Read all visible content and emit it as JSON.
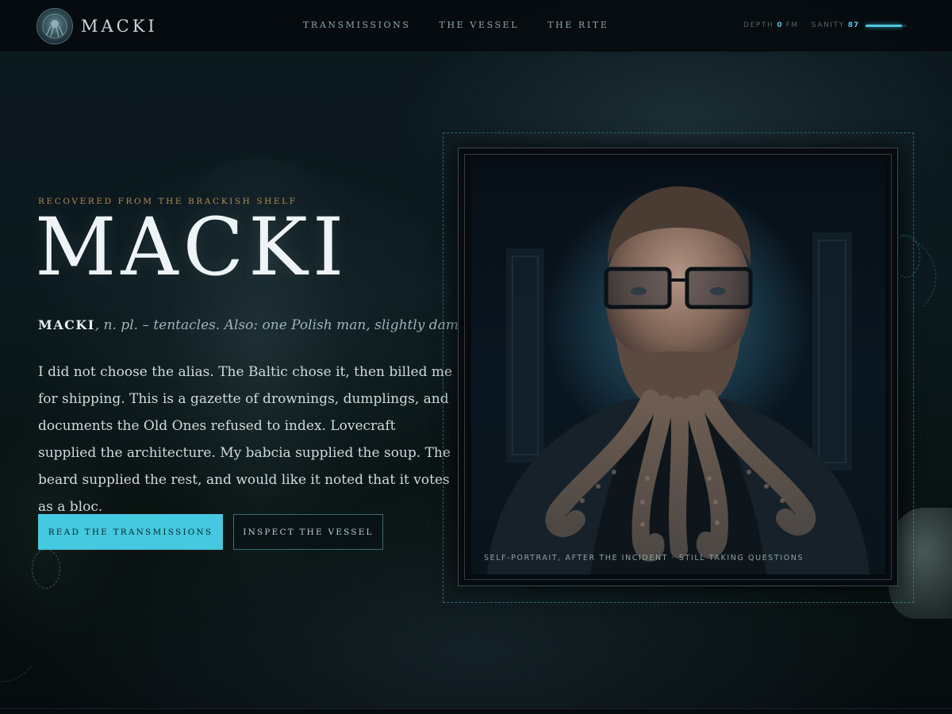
{
  "brand": {
    "name": "MACKI"
  },
  "nav": {
    "items": [
      {
        "label": "TRANSMISSIONS"
      },
      {
        "label": "THE VESSEL"
      },
      {
        "label": "THE RITE"
      }
    ]
  },
  "meters": {
    "depth_label": "DEPTH",
    "depth_value": "0",
    "depth_unit": "FM",
    "sanity_label": "SANITY",
    "sanity_value": "87",
    "sanity_fraction": 0.87
  },
  "hero": {
    "kicker": "RECOVERED FROM THE BRACKISH SHELF",
    "title": "MACKI",
    "definition_word": "MACKI",
    "definition_rest": ", n. pl. – tentacles. Also: one Polish man, slightly damp.",
    "intro": "I did not choose the alias. The Baltic chose it, then billed me for shipping. This is a gazette of drownings, dumplings, and documents the Old Ones refused to index. Lovecraft supplied the architecture. My babcia supplied the soup. The beard supplied the rest, and would like it noted that it votes as a bloc.",
    "primary_button": "READ THE TRANSMISSIONS",
    "secondary_button": "INSPECT THE VESSEL"
  },
  "portrait": {
    "caption": "SELF-PORTRAIT, AFTER THE INCIDENT · STILL TAKING QUESTIONS"
  },
  "colors": {
    "accent": "#45c9e0",
    "kicker": "#b08a56",
    "background": "#071014"
  }
}
